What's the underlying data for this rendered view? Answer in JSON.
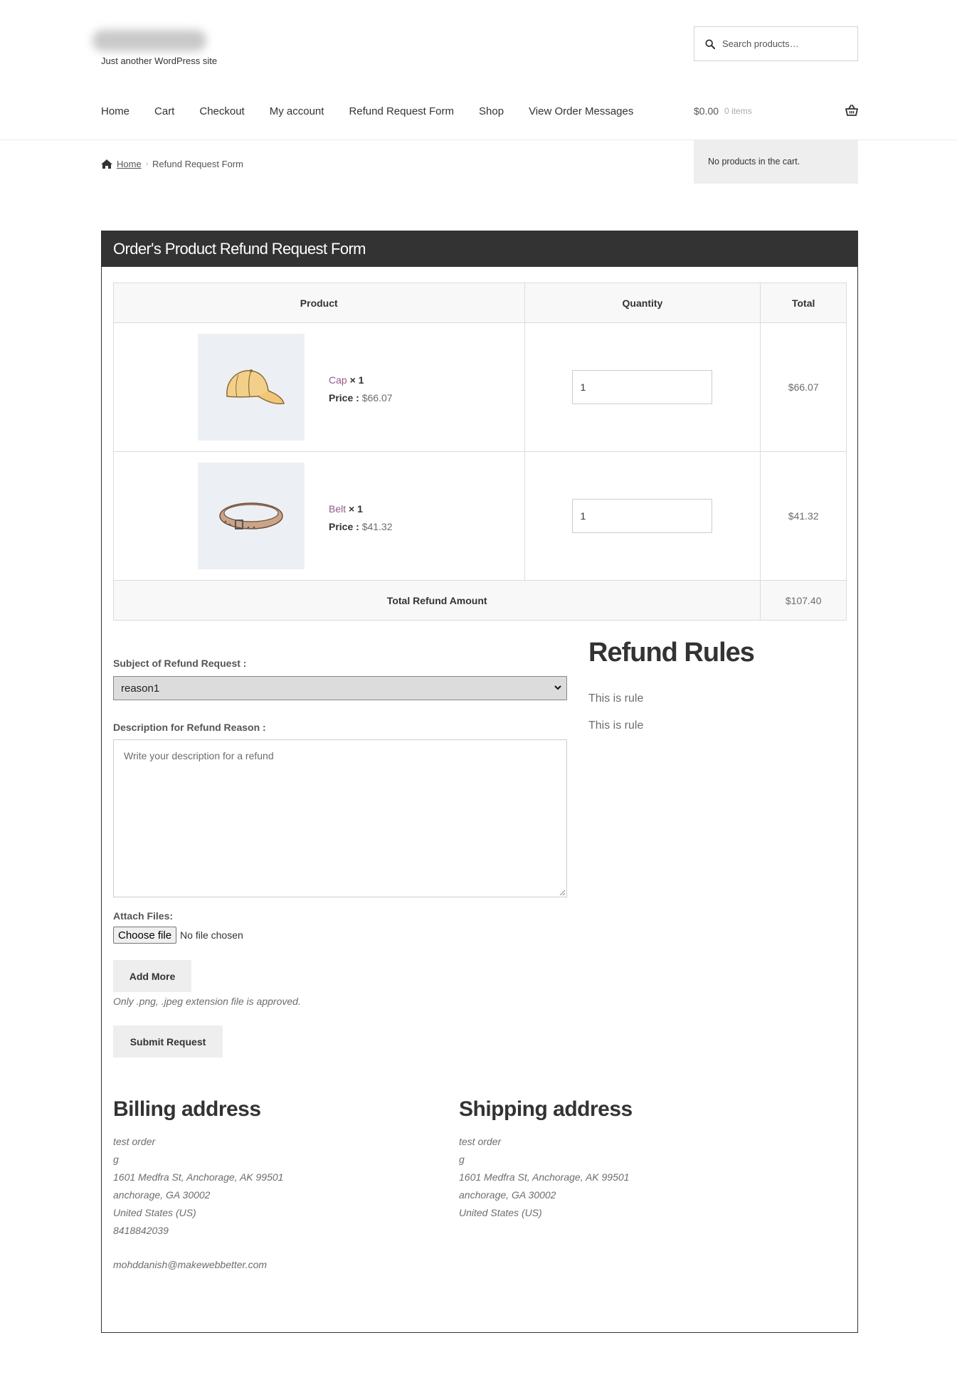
{
  "header": {
    "site_title": "Site Title",
    "tagline": "Just another WordPress site",
    "search_placeholder": "Search products…"
  },
  "nav": {
    "items": [
      "Home",
      "Cart",
      "Checkout",
      "My account",
      "Refund Request Form",
      "Shop",
      "View Order Messages"
    ]
  },
  "cart": {
    "amount": "$0.00",
    "count": "0 items",
    "mini_cart_text": "No products in the cart."
  },
  "breadcrumb": {
    "home": "Home",
    "current": "Refund Request Form"
  },
  "form": {
    "title": "Order's Product Refund Request Form",
    "columns": [
      "Product",
      "Quantity",
      "Total"
    ],
    "products": [
      {
        "name": "Cap",
        "qty_label": "× 1",
        "price_label": "Price :",
        "price": "$66.07",
        "quantity": "1",
        "total": "$66.07",
        "icon": "cap-icon"
      },
      {
        "name": "Belt",
        "qty_label": "× 1",
        "price_label": "Price :",
        "price": "$41.32",
        "quantity": "1",
        "total": "$41.32",
        "icon": "belt-icon"
      }
    ],
    "total_label": "Total Refund Amount",
    "total_value": "$107.40",
    "subject_label": "Subject of Refund Request :",
    "subject_value": "reason1",
    "description_label": "Description for Refund Reason :",
    "description_placeholder": "Write your description for a refund",
    "attach_label": "Attach Files:",
    "choose_file": "Choose file",
    "no_file": "No file chosen",
    "add_more": "Add More",
    "file_note": "Only .png, .jpeg extension file is approved.",
    "submit": "Submit Request"
  },
  "rules": {
    "title": "Refund Rules",
    "items": [
      "This is rule",
      "This is rule"
    ]
  },
  "billing": {
    "title": "Billing address",
    "lines": [
      "test order",
      "g",
      "1601 Medfra St, Anchorage, AK 99501",
      "anchorage, GA 30002",
      "United States (US)",
      "8418842039"
    ],
    "email": "mohddanish@makewebbetter.com"
  },
  "shipping": {
    "title": "Shipping address",
    "lines": [
      "test order",
      "g",
      "1601 Medfra St, Anchorage, AK 99501",
      "anchorage, GA 30002",
      "United States (US)"
    ]
  },
  "colors": {
    "panel_header": "#333333",
    "product_link": "#96588a",
    "button_bg": "#eeeeee"
  }
}
